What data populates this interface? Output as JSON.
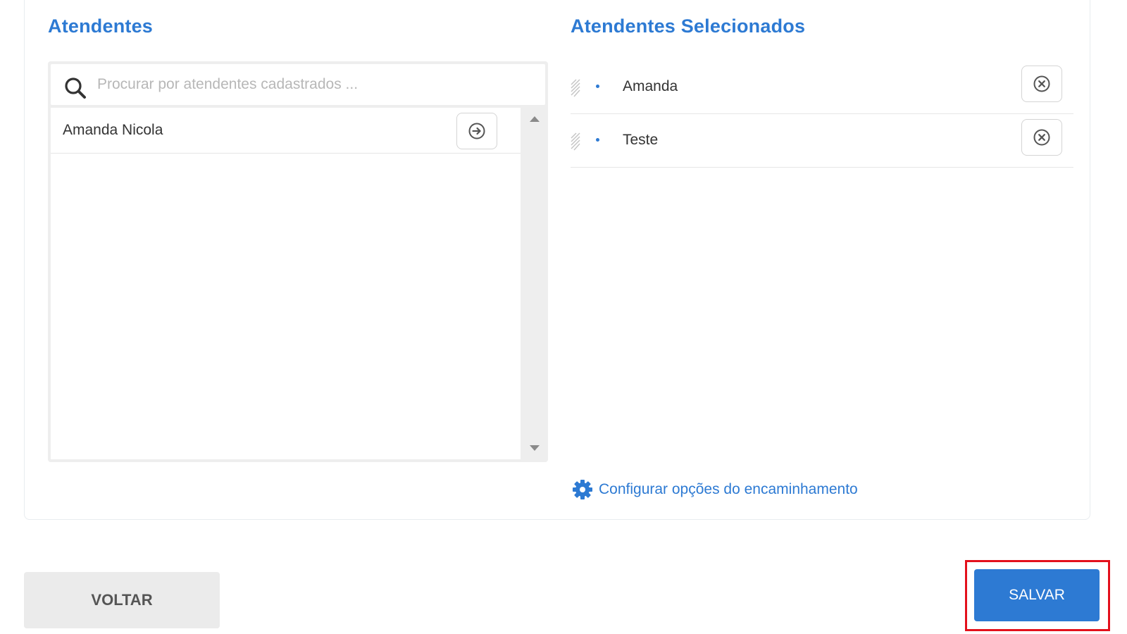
{
  "left_column": {
    "title": "Atendentes",
    "search": {
      "placeholder": "Procurar por atendentes cadastrados ...",
      "value": ""
    },
    "items": [
      {
        "label": "Amanda Nicola",
        "action_icon": "arrow-right-circle-icon"
      }
    ]
  },
  "right_column": {
    "title": "Atendentes Selecionados",
    "items": [
      {
        "label": "Amanda",
        "action_icon": "close-circle-icon"
      },
      {
        "label": "Teste",
        "action_icon": "close-circle-icon"
      }
    ],
    "config_link": "Configurar opções do encaminhamento"
  },
  "footer": {
    "back_label": "VOLTAR",
    "save_label": "SALVAR"
  },
  "colors": {
    "accent": "#2d7ad3",
    "highlight": "#e3101c",
    "secondary_button": "#ebebeb"
  }
}
